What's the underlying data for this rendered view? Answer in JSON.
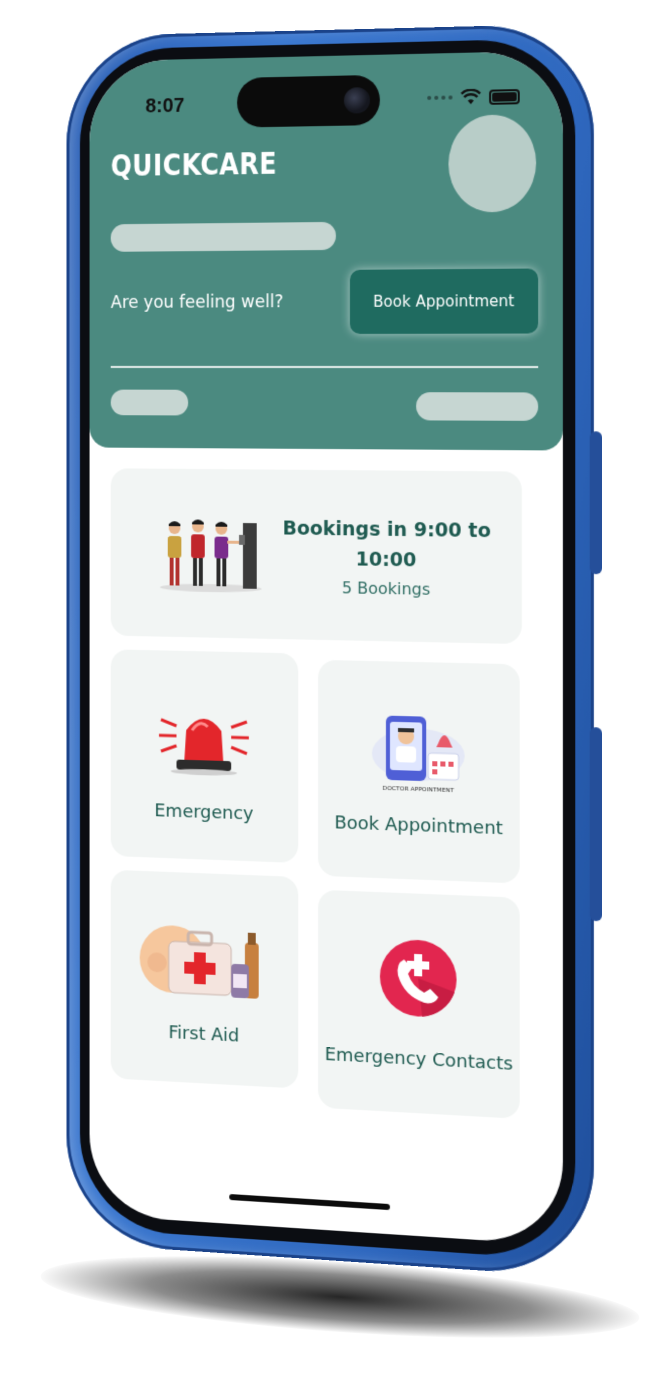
{
  "status": {
    "time": "8:07"
  },
  "header": {
    "app_title": "QUICKCARE",
    "prompt": "Are you feeling well?",
    "book_button_label": "Book Appointment"
  },
  "booking_card": {
    "title": "Bookings in 9:00 to 10:00",
    "count": "5 Bookings"
  },
  "tiles": [
    {
      "label": "Emergency",
      "icon": "siren-icon"
    },
    {
      "label": "Book Appointment",
      "icon": "doctor-appointment-illustration",
      "caption": "DOCTOR APPOINTMENT"
    },
    {
      "label": "First Aid",
      "icon": "first-aid-kit-illustration"
    },
    {
      "label": "Emergency Contacts",
      "icon": "medical-phone-icon"
    }
  ],
  "colors": {
    "header_bg": "#4b8a80",
    "button_bg": "#1f6b60",
    "card_bg": "#f2f5f4",
    "text_teal": "#1e5a50",
    "frame_blue": "#2f68bf"
  }
}
